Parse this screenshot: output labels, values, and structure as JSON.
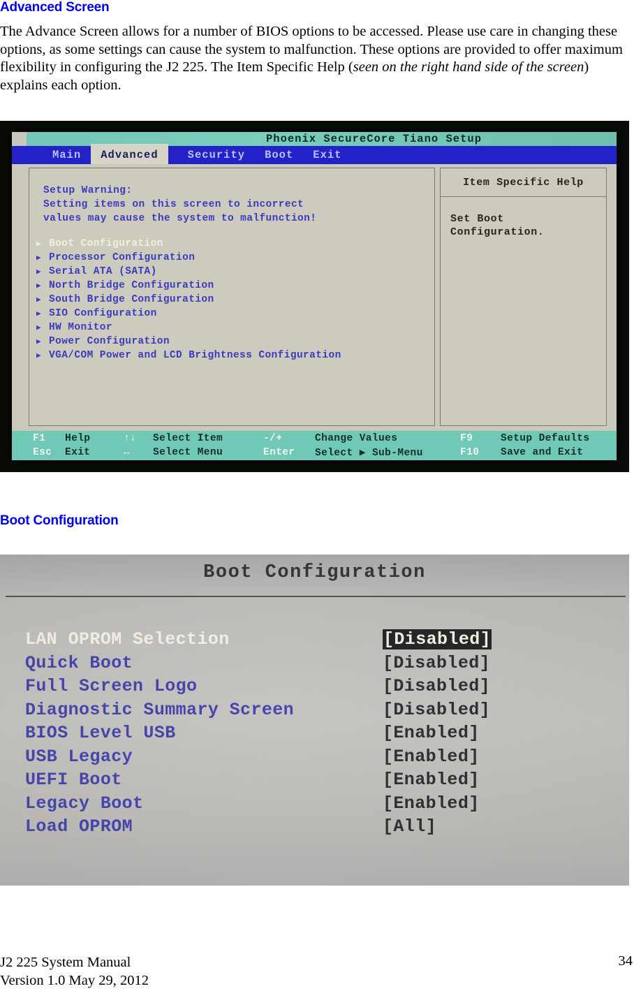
{
  "document": {
    "heading_1": "Advanced Screen",
    "paragraph_1_a": "The Advance Screen allows for a number of BIOS options to be accessed. Please use care in changing these options, as some settings can cause the system to malfunction. These options are provided to offer maximum flexibility in configuring the J2 225. The Item Specific Help (",
    "paragraph_1_italic": "seen on the right hand side of the screen",
    "paragraph_1_b": ") explains each option.",
    "heading_2": "Boot Configuration",
    "footer_left": "J2 225 System Manual\nVersion 1.0 May 29, 2012",
    "footer_page": "34"
  },
  "bios_advanced": {
    "title": "Phoenix SecureCore Tiano Setup",
    "tabs": [
      {
        "label": "Main",
        "active": false
      },
      {
        "label": "Advanced",
        "active": true
      },
      {
        "label": "Security",
        "active": false
      },
      {
        "label": "Boot",
        "active": false
      },
      {
        "label": "Exit",
        "active": false
      }
    ],
    "warning": "Setup Warning:\nSetting items on this screen to incorrect\nvalues may cause the system to malfunction!",
    "menu_items": [
      {
        "label": "Boot Configuration",
        "selected": true
      },
      {
        "label": "Processor Configuration",
        "selected": false
      },
      {
        "label": "Serial ATA (SATA)",
        "selected": false
      },
      {
        "label": "North Bridge Configuration",
        "selected": false
      },
      {
        "label": "South Bridge Configuration",
        "selected": false
      },
      {
        "label": "SIO Configuration",
        "selected": false
      },
      {
        "label": "HW Monitor",
        "selected": false
      },
      {
        "label": "Power Configuration",
        "selected": false
      },
      {
        "label": "VGA/COM Power and LCD Brightness Configuration",
        "selected": false
      }
    ],
    "help_panel": {
      "title": "Item Specific Help",
      "body": "Set Boot\nConfiguration."
    },
    "key_bar": {
      "row1": {
        "key1": "F1",
        "desc1": "Help",
        "key2": "↑↓",
        "desc2": "Select Item",
        "key3": "-/+",
        "desc3": "Change Values",
        "key4": "F9",
        "desc4": "Setup Defaults"
      },
      "row2": {
        "key1": "Esc",
        "desc1": "Exit",
        "key2": "↔",
        "desc2": "Select Menu",
        "key3": "Enter",
        "desc3": "Select ▶ Sub-Menu",
        "key4": "F10",
        "desc4": "Save and Exit"
      }
    },
    "colors": {
      "title_bar": "#74c7b6",
      "menu_bar": "#2222c8",
      "screen_bg": "#cbc9bc",
      "text_blue": "#3b3bbe",
      "selected_text": "#f2f0d8",
      "key_bar": "#6fc9b6"
    }
  },
  "bios_boot_config": {
    "title": "Boot Configuration",
    "rows": [
      {
        "label": "LAN OPROM Selection",
        "value": "[Disabled]",
        "selected": true
      },
      {
        "label": "Quick Boot",
        "value": "[Disabled]",
        "selected": false
      },
      {
        "label": "Full Screen Logo",
        "value": "[Disabled]",
        "selected": false
      },
      {
        "label": "Diagnostic Summary Screen",
        "value": "[Disabled]",
        "selected": false
      },
      {
        "label": "BIOS Level USB",
        "value": "[Enabled]",
        "selected": false
      },
      {
        "label": "USB Legacy",
        "value": "[Enabled]",
        "selected": false
      },
      {
        "label": "UEFI Boot",
        "value": "[Enabled]",
        "selected": false
      },
      {
        "label": "Legacy Boot",
        "value": "[Enabled]",
        "selected": false
      },
      {
        "label": "Load OPROM",
        "value": "[All]",
        "selected": false
      }
    ],
    "colors": {
      "screen_bg": "#c4c2bf",
      "text_blue": "#3c3ca8",
      "value_text": "#262426",
      "selected_bg": "#1c1a1c",
      "selected_text": "#f4f2e4"
    }
  }
}
